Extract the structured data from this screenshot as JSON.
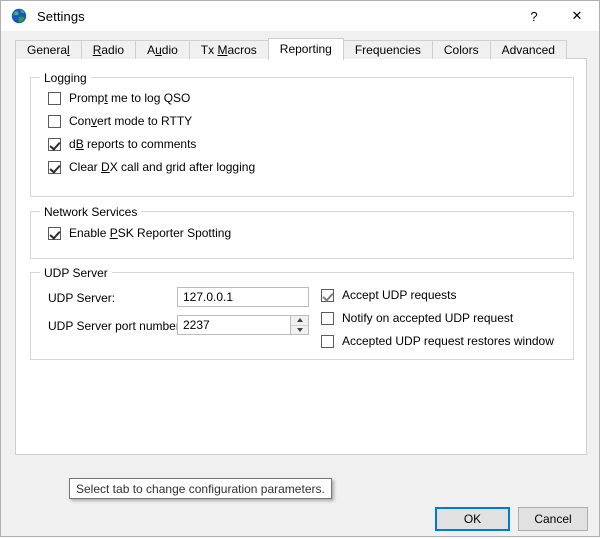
{
  "window": {
    "title": "Settings",
    "icon": "globe-icon",
    "help_label": "?",
    "close_label": "✕"
  },
  "tabs": [
    {
      "label": "General",
      "mnemonic_index": 6,
      "active": false
    },
    {
      "label": "Radio",
      "mnemonic_index": 0,
      "active": false
    },
    {
      "label": "Audio",
      "mnemonic_index": 1,
      "active": false
    },
    {
      "label": "Tx Macros",
      "mnemonic_index": 3,
      "active": false
    },
    {
      "label": "Reporting",
      "mnemonic_index": 8,
      "active": true
    },
    {
      "label": "Frequencies",
      "mnemonic_index": -1,
      "active": false
    },
    {
      "label": "Colors",
      "mnemonic_index": -1,
      "active": false
    },
    {
      "label": "Advanced",
      "mnemonic_index": -1,
      "active": false
    }
  ],
  "groups": {
    "logging": {
      "legend": "Logging",
      "checkboxes": [
        {
          "label": "Prompt me to log QSO",
          "mnemonic_index": 5,
          "checked": false,
          "dim": false
        },
        {
          "label": "Convert mode to RTTY",
          "mnemonic_index": 3,
          "checked": false,
          "dim": false
        },
        {
          "label": "dB reports to comments",
          "mnemonic_index": 1,
          "checked": true,
          "dim": false
        },
        {
          "label": "Clear DX call and grid after logging",
          "mnemonic_index": 6,
          "checked": true,
          "dim": false
        }
      ]
    },
    "network_services": {
      "legend": "Network Services",
      "checkboxes": [
        {
          "label": "Enable PSK Reporter Spotting",
          "mnemonic_index": 7,
          "checked": true,
          "dim": false
        }
      ]
    },
    "udp_server": {
      "legend": "UDP Server",
      "fields": [
        {
          "label": "UDP Server:",
          "value": "127.0.0.1",
          "type": "text"
        },
        {
          "label": "UDP Server port number:",
          "value": "2237",
          "type": "spinbox"
        }
      ],
      "checkboxes": [
        {
          "label": "Accept UDP requests",
          "mnemonic_index": -1,
          "checked": true,
          "dim": true
        },
        {
          "label": "Notify on accepted UDP request",
          "mnemonic_index": -1,
          "checked": false,
          "dim": false
        },
        {
          "label": "Accepted UDP request restores window",
          "mnemonic_index": -1,
          "checked": false,
          "dim": false
        }
      ]
    }
  },
  "tooltip": {
    "text": "Select tab to change configuration parameters."
  },
  "footer": {
    "ok_label": "OK",
    "cancel_label": "Cancel"
  },
  "colors": {
    "accent": "#0078d7",
    "window_bg": "#f0f0f0",
    "panel_bg": "#ffffff",
    "border": "#cfcfcf"
  }
}
